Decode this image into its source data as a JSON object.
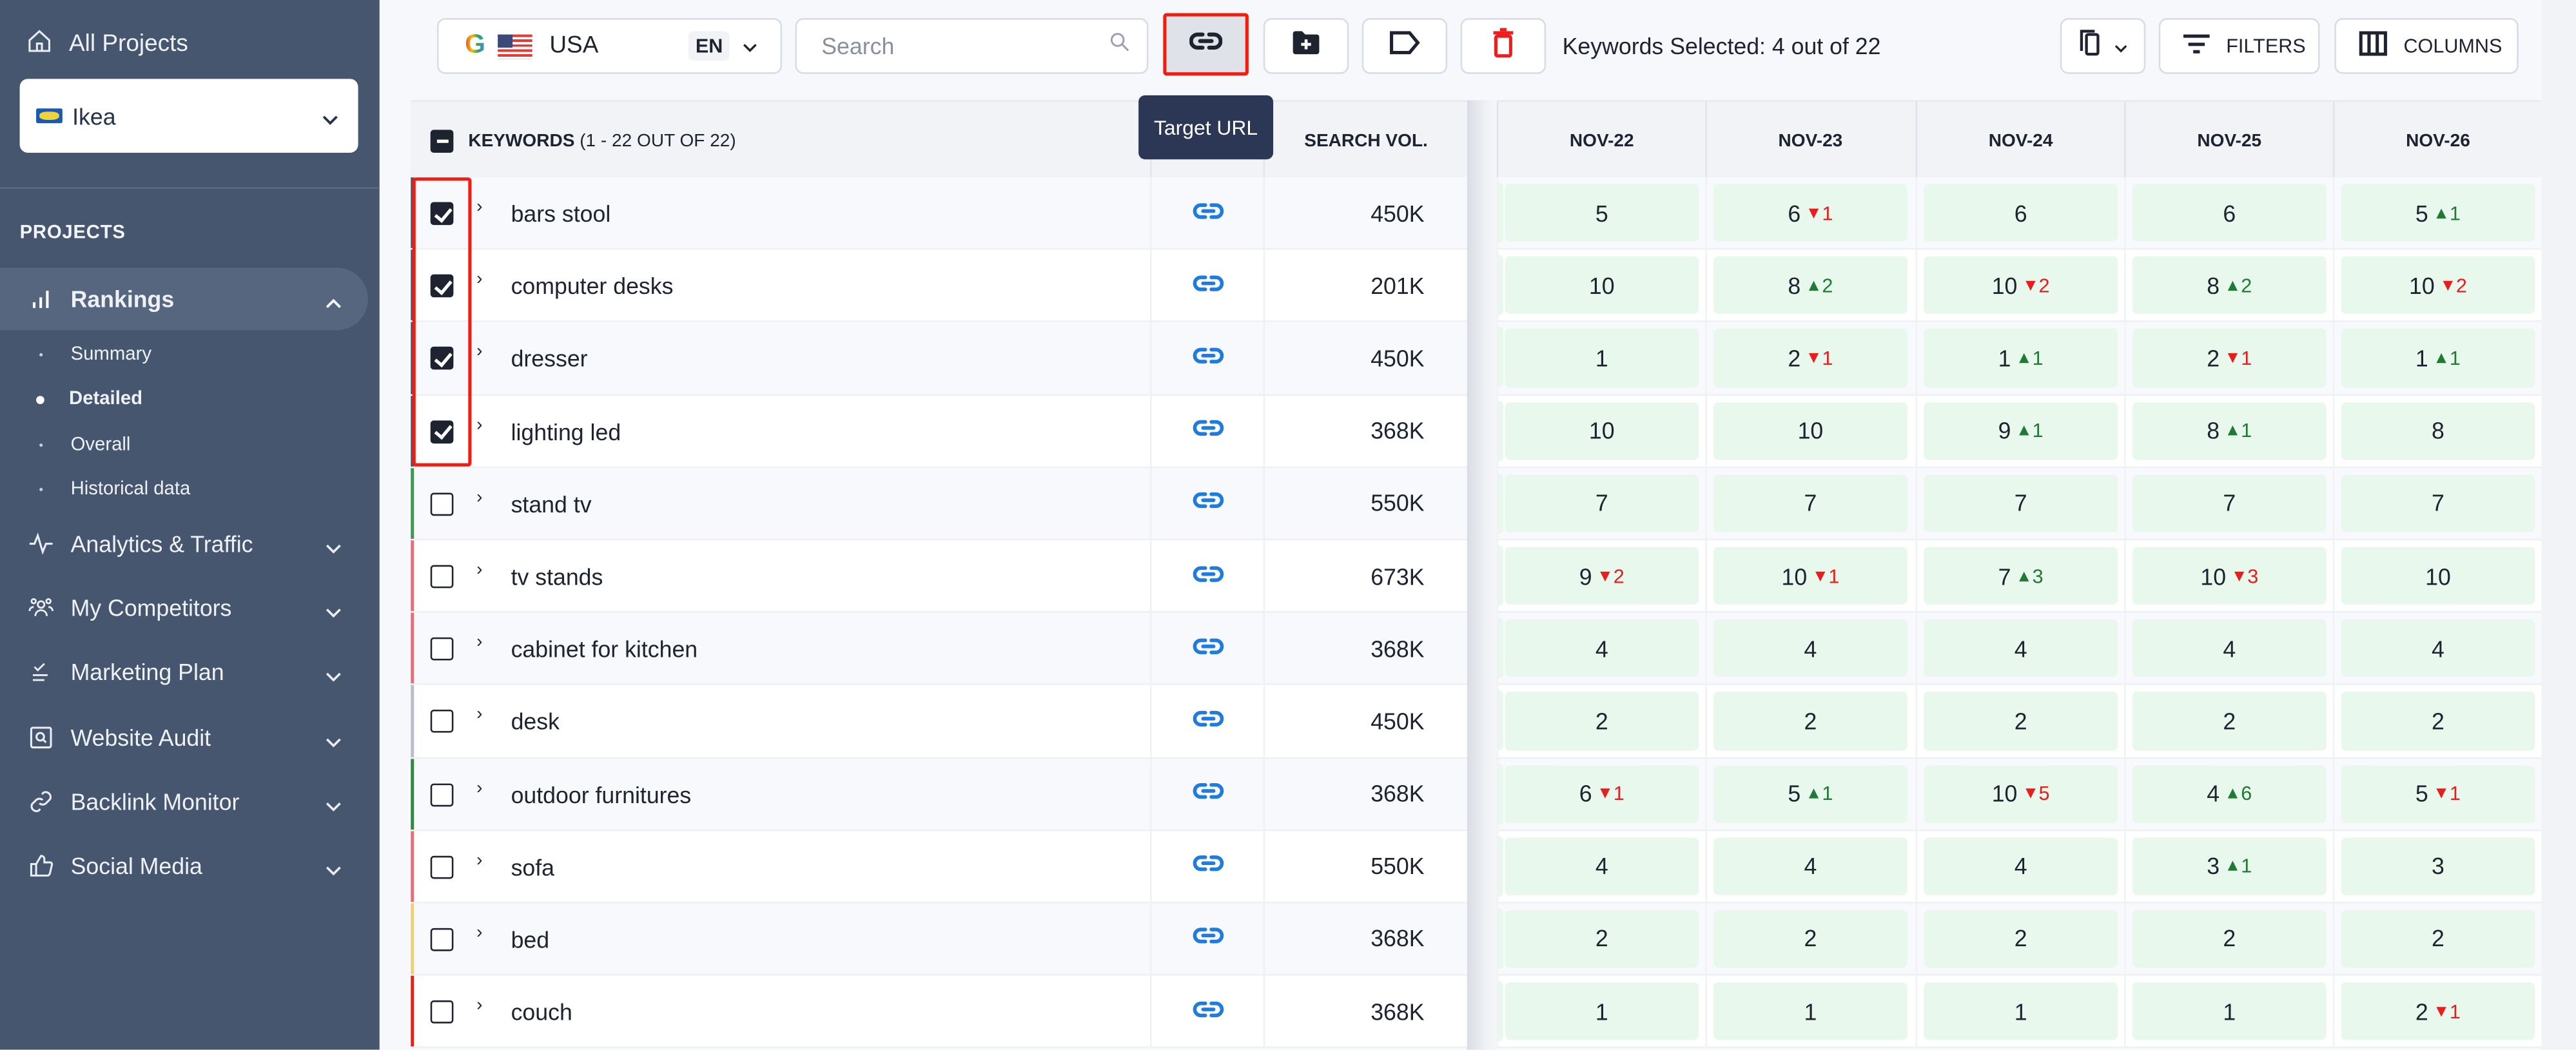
{
  "sidebar": {
    "all_projects": "All Projects",
    "project": {
      "name": "Ikea",
      "logo": "ikea-logo"
    },
    "section_label": "PROJECTS",
    "items": [
      {
        "label": "Rankings",
        "icon": "bar-chart-icon",
        "active": true,
        "expanded": true,
        "children": [
          {
            "label": "Summary",
            "active": false
          },
          {
            "label": "Detailed",
            "active": true
          },
          {
            "label": "Overall",
            "active": false
          },
          {
            "label": "Historical data",
            "active": false
          }
        ]
      },
      {
        "label": "Analytics & Traffic",
        "icon": "pulse-icon"
      },
      {
        "label": "My Competitors",
        "icon": "users-icon"
      },
      {
        "label": "Marketing Plan",
        "icon": "checklist-icon"
      },
      {
        "label": "Website Audit",
        "icon": "search-square-icon"
      },
      {
        "label": "Backlink Monitor",
        "icon": "link-icon"
      },
      {
        "label": "Social Media",
        "icon": "thumbs-up-icon"
      }
    ]
  },
  "toolbar": {
    "engine": "G",
    "country": "USA",
    "language": "EN",
    "search_placeholder": "Search",
    "search_value": "",
    "selected_text": "Keywords Selected: 4 out of 22",
    "filters_label": "FILTERS",
    "columns_label": "COLUMNS",
    "tooltip": "Target URL"
  },
  "table": {
    "keyword_header": "KEYWORDS",
    "keyword_count": "(1 - 22 OUT OF 22)",
    "url_header": "",
    "volume_header": "SEARCH VOL.",
    "dates": [
      "NOV-22",
      "NOV-23",
      "NOV-24",
      "NOV-25",
      "NOV-26"
    ],
    "colors": {
      "up": "#1f7a35",
      "down": "#ea1c1c",
      "highlight": "#f01e12",
      "cell_bg": "#e8f8ec",
      "link": "#1e7be0"
    },
    "rows": [
      {
        "keyword": "bars stool",
        "checked": true,
        "volume": "450K",
        "bar": "#46566f",
        "ranks": [
          {
            "v": "5"
          },
          {
            "v": "6",
            "dir": "down",
            "d": "1"
          },
          {
            "v": "6"
          },
          {
            "v": "6"
          },
          {
            "v": "5",
            "dir": "up",
            "d": "1"
          }
        ]
      },
      {
        "keyword": "computer desks",
        "checked": true,
        "volume": "201K",
        "bar": "#46566f",
        "ranks": [
          {
            "v": "10"
          },
          {
            "v": "8",
            "dir": "up",
            "d": "2"
          },
          {
            "v": "10",
            "dir": "down",
            "d": "2"
          },
          {
            "v": "8",
            "dir": "up",
            "d": "2"
          },
          {
            "v": "10",
            "dir": "down",
            "d": "2"
          }
        ]
      },
      {
        "keyword": "dresser",
        "checked": true,
        "volume": "450K",
        "bar": "#46566f",
        "ranks": [
          {
            "v": "1"
          },
          {
            "v": "2",
            "dir": "down",
            "d": "1"
          },
          {
            "v": "1",
            "dir": "up",
            "d": "1"
          },
          {
            "v": "2",
            "dir": "down",
            "d": "1"
          },
          {
            "v": "1",
            "dir": "up",
            "d": "1"
          }
        ]
      },
      {
        "keyword": "lighting led",
        "checked": true,
        "volume": "368K",
        "bar": "#46566f",
        "ranks": [
          {
            "v": "10"
          },
          {
            "v": "10"
          },
          {
            "v": "9",
            "dir": "up",
            "d": "1"
          },
          {
            "v": "8",
            "dir": "up",
            "d": "1"
          },
          {
            "v": "8"
          }
        ]
      },
      {
        "keyword": "stand tv",
        "checked": false,
        "volume": "550K",
        "bar": "#3c9a4e",
        "ranks": [
          {
            "v": "7"
          },
          {
            "v": "7"
          },
          {
            "v": "7"
          },
          {
            "v": "7"
          },
          {
            "v": "7"
          }
        ]
      },
      {
        "keyword": "tv stands",
        "checked": false,
        "volume": "673K",
        "bar": "#ee6b78",
        "ranks": [
          {
            "v": "9",
            "dir": "down",
            "d": "2"
          },
          {
            "v": "10",
            "dir": "down",
            "d": "1"
          },
          {
            "v": "7",
            "dir": "up",
            "d": "3"
          },
          {
            "v": "10",
            "dir": "down",
            "d": "3"
          },
          {
            "v": "10"
          }
        ]
      },
      {
        "keyword": "cabinet for kitchen",
        "checked": false,
        "volume": "368K",
        "bar": "#ee6b78",
        "ranks": [
          {
            "v": "4"
          },
          {
            "v": "4"
          },
          {
            "v": "4"
          },
          {
            "v": "4"
          },
          {
            "v": "4"
          }
        ]
      },
      {
        "keyword": "desk",
        "checked": false,
        "volume": "450K",
        "bar": "#b9bec7",
        "ranks": [
          {
            "v": "2"
          },
          {
            "v": "2"
          },
          {
            "v": "2"
          },
          {
            "v": "2"
          },
          {
            "v": "2"
          }
        ]
      },
      {
        "keyword": "outdoor furnitures",
        "checked": false,
        "volume": "368K",
        "bar": "#2e8b3e",
        "ranks": [
          {
            "v": "6",
            "dir": "down",
            "d": "1"
          },
          {
            "v": "5",
            "dir": "up",
            "d": "1"
          },
          {
            "v": "10",
            "dir": "down",
            "d": "5"
          },
          {
            "v": "4",
            "dir": "up",
            "d": "6"
          },
          {
            "v": "5",
            "dir": "down",
            "d": "1"
          }
        ]
      },
      {
        "keyword": "sofa",
        "checked": false,
        "volume": "550K",
        "bar": "#ee6b78",
        "ranks": [
          {
            "v": "4"
          },
          {
            "v": "4"
          },
          {
            "v": "4"
          },
          {
            "v": "3",
            "dir": "up",
            "d": "1"
          },
          {
            "v": "3"
          }
        ]
      },
      {
        "keyword": "bed",
        "checked": false,
        "volume": "368K",
        "bar": "#f2cf72",
        "ranks": [
          {
            "v": "2"
          },
          {
            "v": "2"
          },
          {
            "v": "2"
          },
          {
            "v": "2"
          },
          {
            "v": "2"
          }
        ]
      },
      {
        "keyword": "couch",
        "checked": false,
        "volume": "368K",
        "bar": "#f01e12",
        "ranks": [
          {
            "v": "1"
          },
          {
            "v": "1"
          },
          {
            "v": "1"
          },
          {
            "v": "1"
          },
          {
            "v": "2",
            "dir": "down",
            "d": "1"
          }
        ]
      }
    ]
  }
}
